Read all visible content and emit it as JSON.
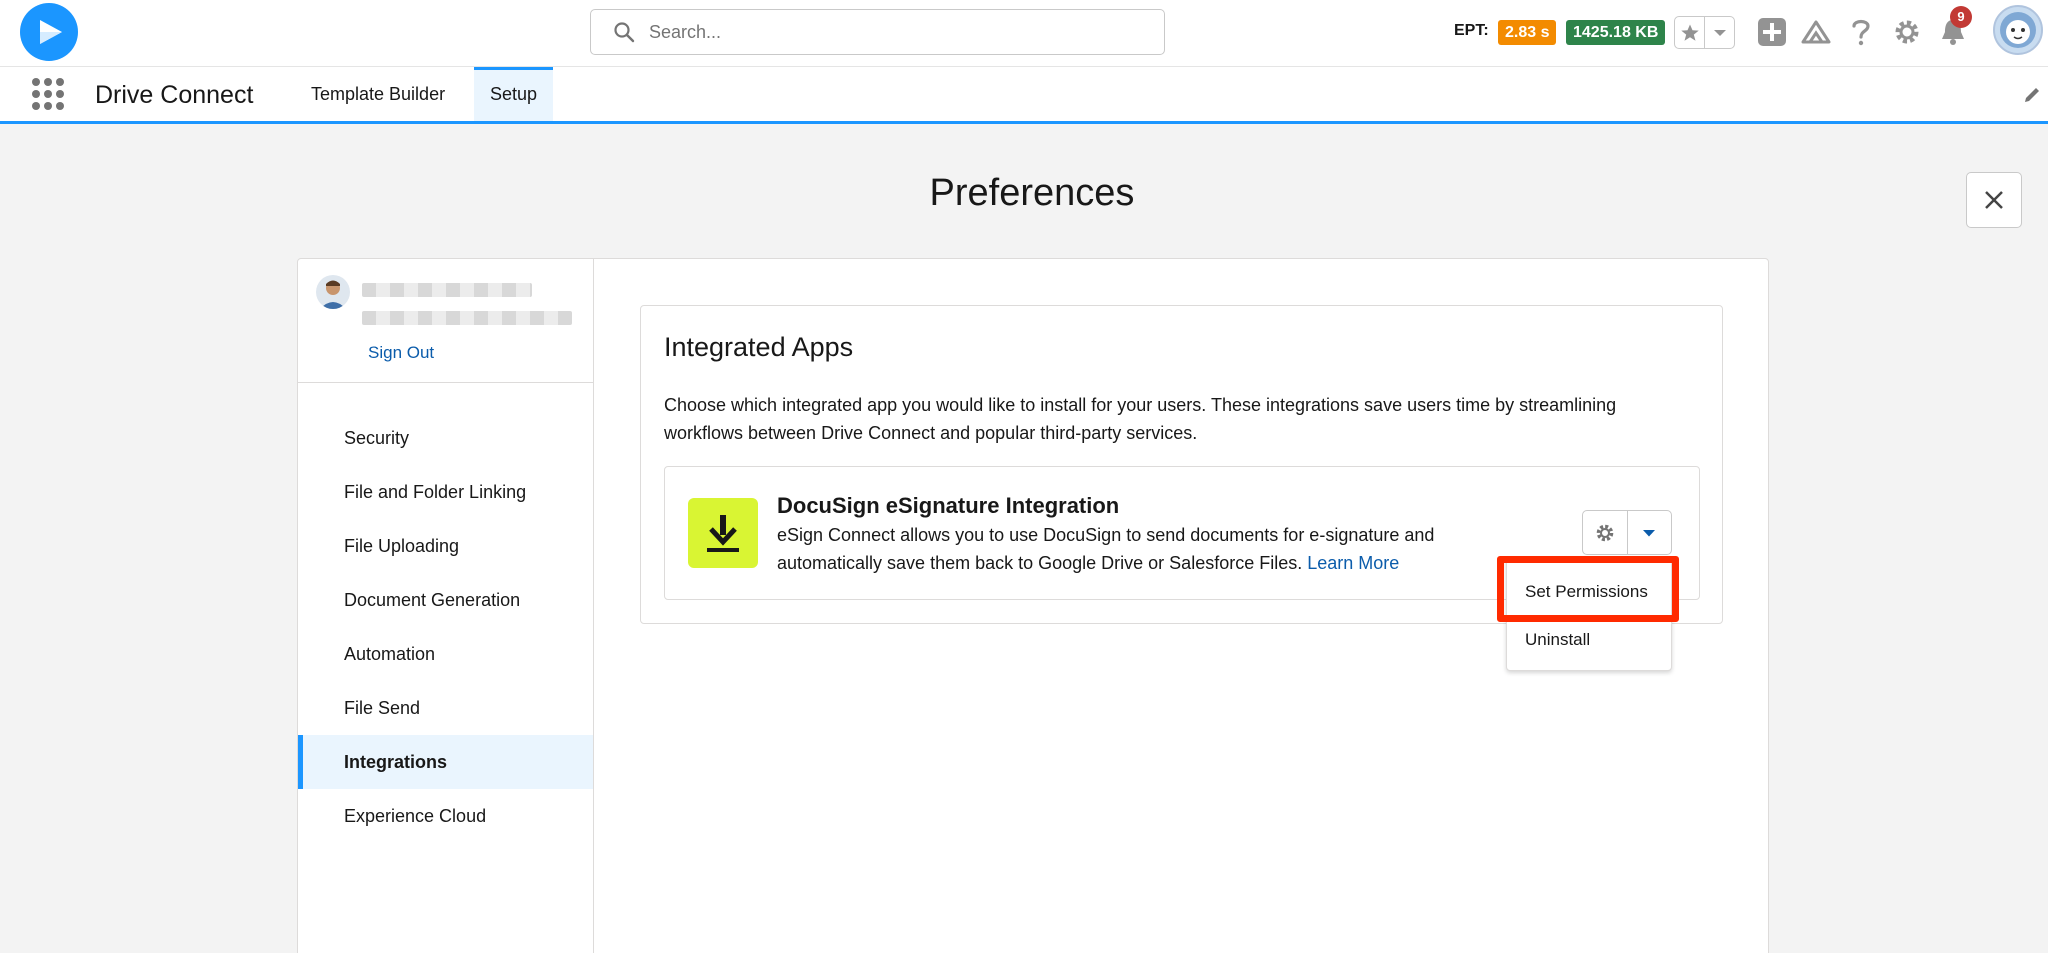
{
  "header": {
    "search_placeholder": "Search...",
    "ept_label": "EPT:",
    "ept_time": "2.83 s",
    "ept_size": "1425.18 KB",
    "notification_count": "9"
  },
  "appnav": {
    "app_name": "Drive Connect",
    "tabs": [
      {
        "label": "Template Builder",
        "active": false
      },
      {
        "label": "Setup",
        "active": true
      }
    ]
  },
  "page": {
    "title": "Preferences"
  },
  "sidebar": {
    "sign_out": "Sign Out",
    "items": [
      {
        "label": "Security",
        "active": false
      },
      {
        "label": "File and Folder Linking",
        "active": false
      },
      {
        "label": "File Uploading",
        "active": false
      },
      {
        "label": "Document Generation",
        "active": false
      },
      {
        "label": "Automation",
        "active": false
      },
      {
        "label": "File Send",
        "active": false
      },
      {
        "label": "Integrations",
        "active": true
      },
      {
        "label": "Experience Cloud",
        "active": false
      }
    ]
  },
  "integrations": {
    "title": "Integrated Apps",
    "description": "Choose which integrated app you would like to install for your users. These integrations save users time by streamlining workflows between Drive Connect and popular third-party services.",
    "app": {
      "name": "DocuSign eSignature Integration",
      "description": "eSign Connect allows you to use DocuSign to send documents for e-signature and automatically save them back to Google Drive or Salesforce Files.",
      "learn_more": "Learn More"
    },
    "menu": {
      "items": [
        "Set Permissions",
        "Uninstall"
      ],
      "highlighted": "Set Permissions"
    }
  },
  "colors": {
    "brand_blue": "#1b96ff",
    "ept_orange": "#f38b00",
    "ept_green": "#2e844a",
    "app_icon_bg": "#d9f533",
    "highlight_red": "#ff2a00"
  }
}
